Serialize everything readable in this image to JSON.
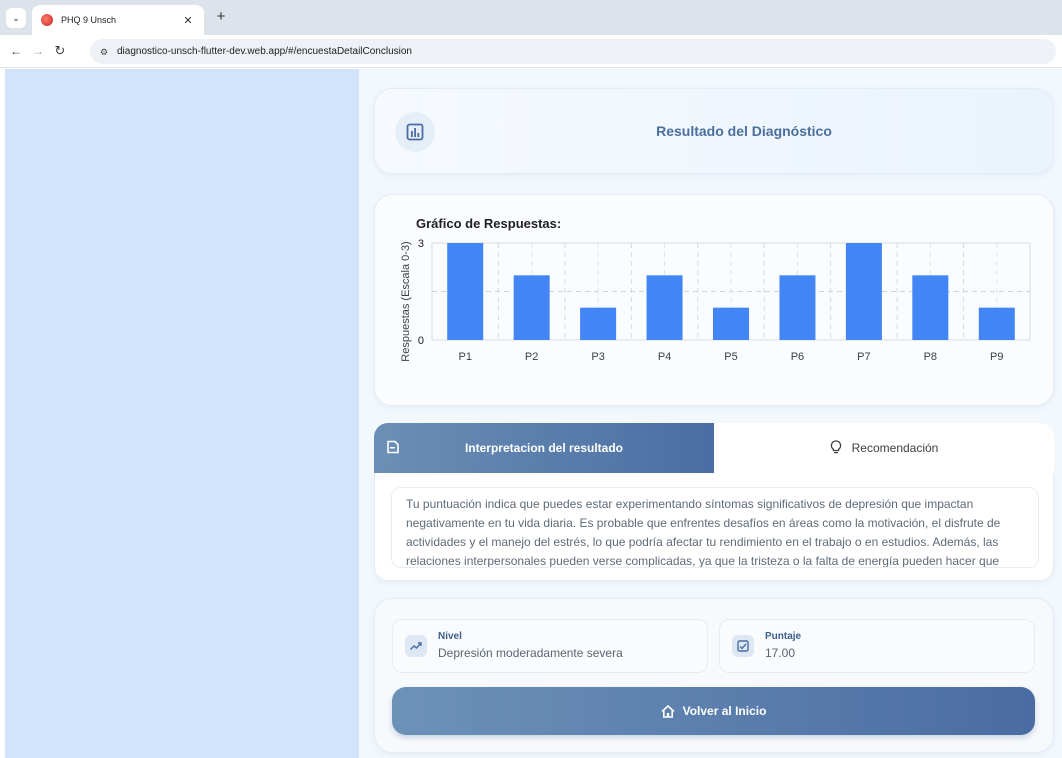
{
  "browser": {
    "tab_title": "PHQ 9 Unsch",
    "url": "diagnostico-unsch-flutter-dev.web.app/#/encuestaDetailConclusion"
  },
  "header": {
    "title": "Resultado del Diagnóstico",
    "icon": "bar-chart-icon"
  },
  "chart_data": {
    "type": "bar",
    "title": "Gráfico de Respuestas:",
    "xlabel": "",
    "ylabel": "Respuestas (Escala 0-3)",
    "categories": [
      "P1",
      "P2",
      "P3",
      "P4",
      "P5",
      "P6",
      "P7",
      "P8",
      "P9"
    ],
    "values": [
      3,
      2,
      1,
      2,
      1,
      2,
      3,
      2,
      1
    ],
    "ylim": [
      0,
      3
    ],
    "yticks": [
      "0",
      "3"
    ],
    "grid": true,
    "bar_color": "#4285f4"
  },
  "tabs": {
    "interpretacion": "Interpretacion del resultado",
    "recomendacion": "Recomendación"
  },
  "interpretacion_text": "Tu puntuación indica que puedes estar experimentando síntomas significativos de depresión que impactan negativamente en tu vida diaria. Es probable que enfrentes desafíos en áreas como la motivación, el disfrute de actividades y el manejo del estrés, lo que podría afectar tu rendimiento en el trabajo o en estudios. Además, las relaciones interpersonales pueden verse complicadas, ya que la tristeza o la falta de energía pueden hacer que",
  "result": {
    "nivel_label": "Nivel",
    "nivel_value": "Depresión moderadamente severa",
    "puntaje_label": "Puntaje",
    "puntaje_value": "17.00"
  },
  "home_button": "Volver al Inicio",
  "colors": {
    "accent": "#4a6ea3",
    "left_panel": "#d2e3fc",
    "bar": "#4285f4"
  }
}
